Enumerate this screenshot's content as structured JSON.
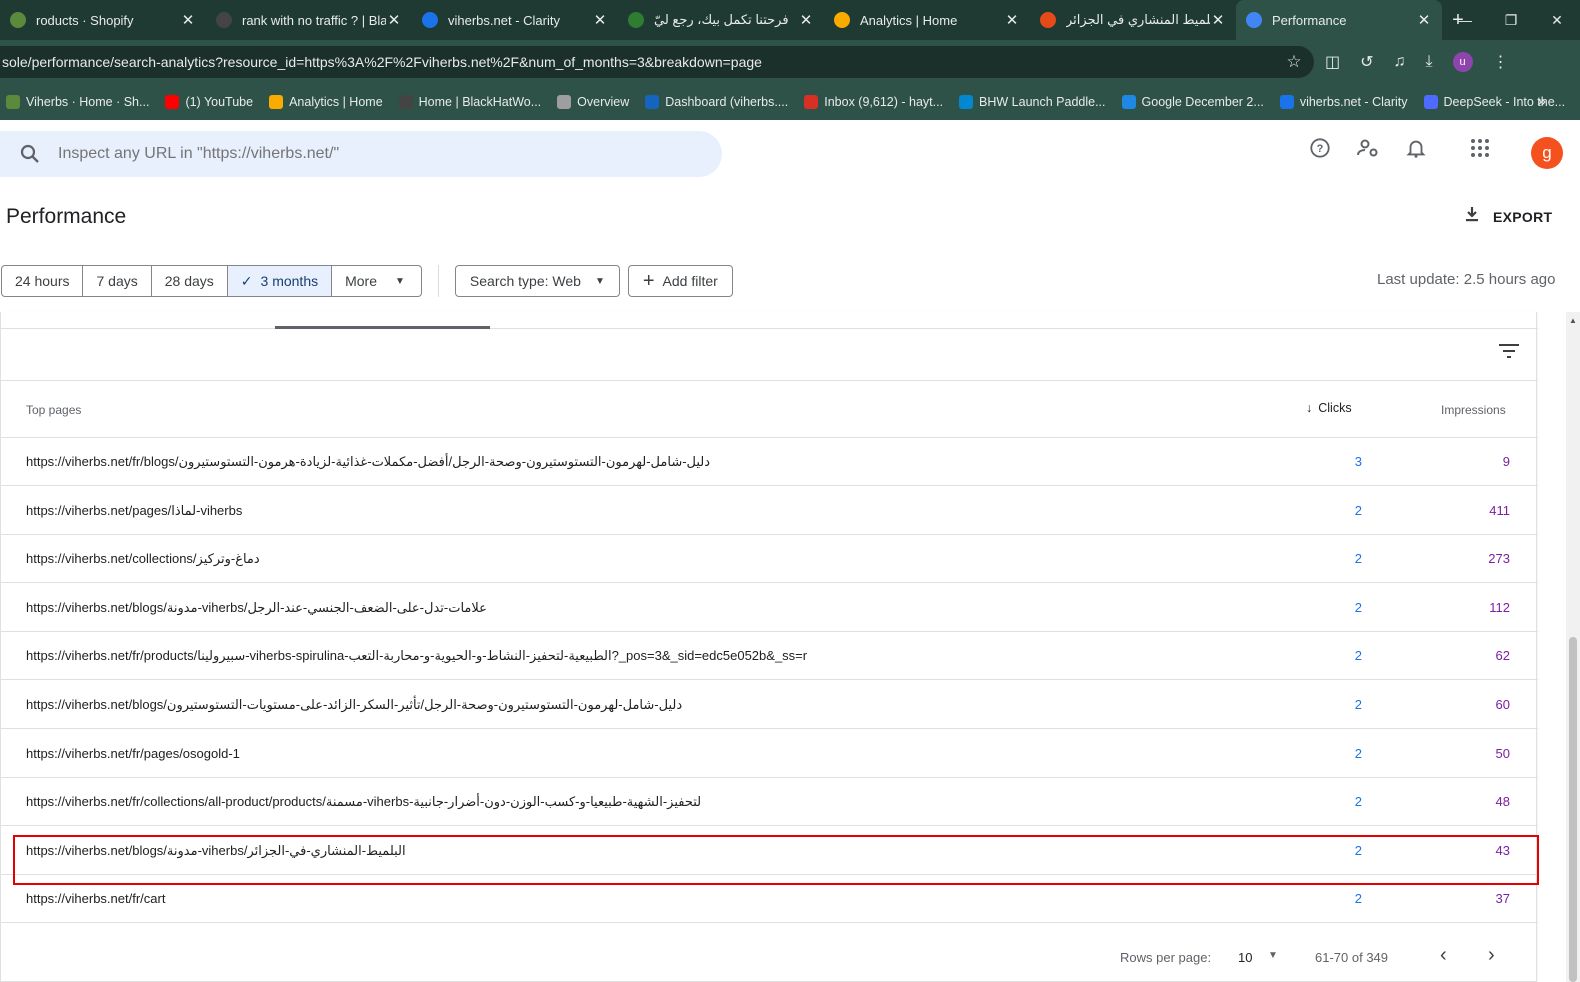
{
  "browser": {
    "tabs": [
      {
        "title": "roducts · Shopify",
        "favicon_color": "#5b8a3c"
      },
      {
        "title": "rank with no traffic ? | BlackHatWorld",
        "favicon_color": "#444444"
      },
      {
        "title": "viherbs.net - Clarity",
        "favicon_color": "#1a73e8"
      },
      {
        "title": "فرحتنا تكمل بيك، رجع ليّ",
        "favicon_color": "#2e7d32"
      },
      {
        "title": "Analytics | Home",
        "favicon_color": "#f9ab00"
      },
      {
        "title": "البلميط المنشاري في الجزائر",
        "favicon_color": "#e64a19"
      },
      {
        "title": "Performance",
        "favicon_color": "#4285f4"
      }
    ],
    "url": "sole/performance/search-analytics?resource_id=https%3A%2F%2Fviherbs.net%2F&num_of_months=3&breakdown=page",
    "profile_initial": "u",
    "bookmarks": [
      {
        "label": "Viherbs · Home · Sh...",
        "color": "#5b8a3c"
      },
      {
        "label": "(1) YouTube",
        "color": "#ff0000"
      },
      {
        "label": "Analytics | Home",
        "color": "#f9ab00"
      },
      {
        "label": "Home | BlackHatWo...",
        "color": "#444444"
      },
      {
        "label": "Overview",
        "color": "#9e9e9e"
      },
      {
        "label": "Dashboard (viherbs....",
        "color": "#1565c0"
      },
      {
        "label": "Inbox (9,612) - hayt...",
        "color": "#d93025"
      },
      {
        "label": "BHW Launch Paddle...",
        "color": "#0288d1"
      },
      {
        "label": "Google December 2...",
        "color": "#1e88e5"
      },
      {
        "label": "viherbs.net - Clarity",
        "color": "#1a73e8"
      },
      {
        "label": "DeepSeek - Into the...",
        "color": "#4d6bfe"
      }
    ]
  },
  "gsc": {
    "search_placeholder": "Inspect any URL in \"https://viherbs.net/\"",
    "avatar_initial": "g",
    "page_title": "Performance",
    "export_label": "EXPORT",
    "date_ranges": [
      "24 hours",
      "7 days",
      "28 days",
      "3 months"
    ],
    "more_label": "More",
    "search_type": "Search type: Web",
    "add_filter": "Add filter",
    "last_update": "Last update: 2.5 hours ago"
  },
  "table": {
    "col_page": "Top pages",
    "col_clicks": "Clicks",
    "col_impressions": "Impressions",
    "rows": [
      {
        "url": "https://viherbs.net/fr/blogs/دليل-شامل-لهرمون-التستوستيرون-وصحة-الرجل/أفضل-مكملات-غذائية-لزيادة-هرمون-التستوستيرون",
        "clicks": "3",
        "impressions": "9"
      },
      {
        "url": "https://viherbs.net/pages/لماذا-viherbs",
        "clicks": "2",
        "impressions": "411"
      },
      {
        "url": "https://viherbs.net/collections/دماغ-وتركيز",
        "clicks": "2",
        "impressions": "273"
      },
      {
        "url": "https://viherbs.net/blogs/مدونة-viherbs/علامات-تدل-على-الضعف-الجنسي-عند-الرجل",
        "clicks": "2",
        "impressions": "112"
      },
      {
        "url": "https://viherbs.net/fr/products/سبيرولينا-viherbs-spirulina-الطبيعية-لتحفيز-النشاط-و-الحيوية-و-محاربة-التعب?_pos=3&_sid=edc5e052b&_ss=r",
        "clicks": "2",
        "impressions": "62"
      },
      {
        "url": "https://viherbs.net/blogs/دليل-شامل-لهرمون-التستوستيرون-وصحة-الرجل/تأثير-السكر-الزائد-على-مستويات-التستوستيرون",
        "clicks": "2",
        "impressions": "60"
      },
      {
        "url": "https://viherbs.net/fr/pages/osogold-1",
        "clicks": "2",
        "impressions": "50"
      },
      {
        "url": "https://viherbs.net/fr/collections/all-product/products/مسمنة-viherbs-لتحفيز-الشهية-طبيعيا-و-كسب-الوزن-دون-أضرار-جانبية",
        "clicks": "2",
        "impressions": "48"
      },
      {
        "url": "https://viherbs.net/blogs/مدونة-viherbs/البلميط-المنشاري-في-الجزائر",
        "clicks": "2",
        "impressions": "43"
      },
      {
        "url": "https://viherbs.net/fr/cart",
        "clicks": "2",
        "impressions": "37"
      }
    ],
    "rows_per_page_label": "Rows per page:",
    "rows_per_page_value": "10",
    "range_label": "61-70 of 349"
  }
}
